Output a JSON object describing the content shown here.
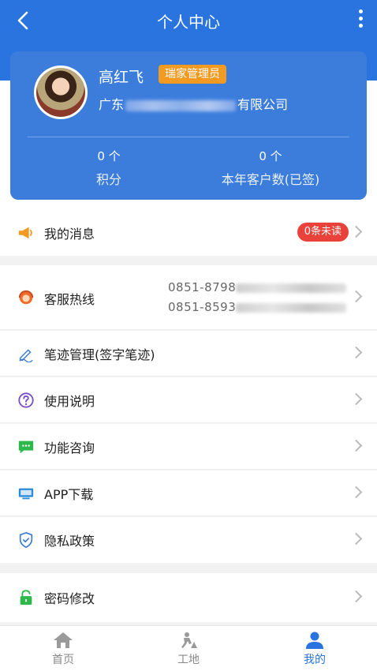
{
  "header": {
    "title": "个人中心"
  },
  "profile": {
    "name": "高红飞",
    "role": "瑞家管理员",
    "company_prefix": "广东",
    "company_suffix": "有限公司",
    "stats": [
      {
        "value": "0 个",
        "label": "积分"
      },
      {
        "value": "0 个",
        "label": "本年客户数(已签)"
      }
    ]
  },
  "menu": {
    "messages": {
      "label": "我的消息",
      "badge": "0条未读"
    },
    "hotline": {
      "label": "客服热线",
      "phone1": "0851-8798",
      "phone2": "0851-8593"
    },
    "signature": {
      "label": "笔迹管理(签字笔迹)"
    },
    "manual": {
      "label": "使用说明"
    },
    "consult": {
      "label": "功能咨询"
    },
    "app_download": {
      "label": "APP下载"
    },
    "privacy": {
      "label": "隐私政策"
    },
    "password": {
      "label": "密码修改"
    }
  },
  "tabs": [
    {
      "label": "首页"
    },
    {
      "label": "工地"
    },
    {
      "label": "我的"
    }
  ],
  "colors": {
    "brand": "#2a74e0",
    "badge_orange": "#f39a22",
    "badge_red": "#e8423b"
  }
}
